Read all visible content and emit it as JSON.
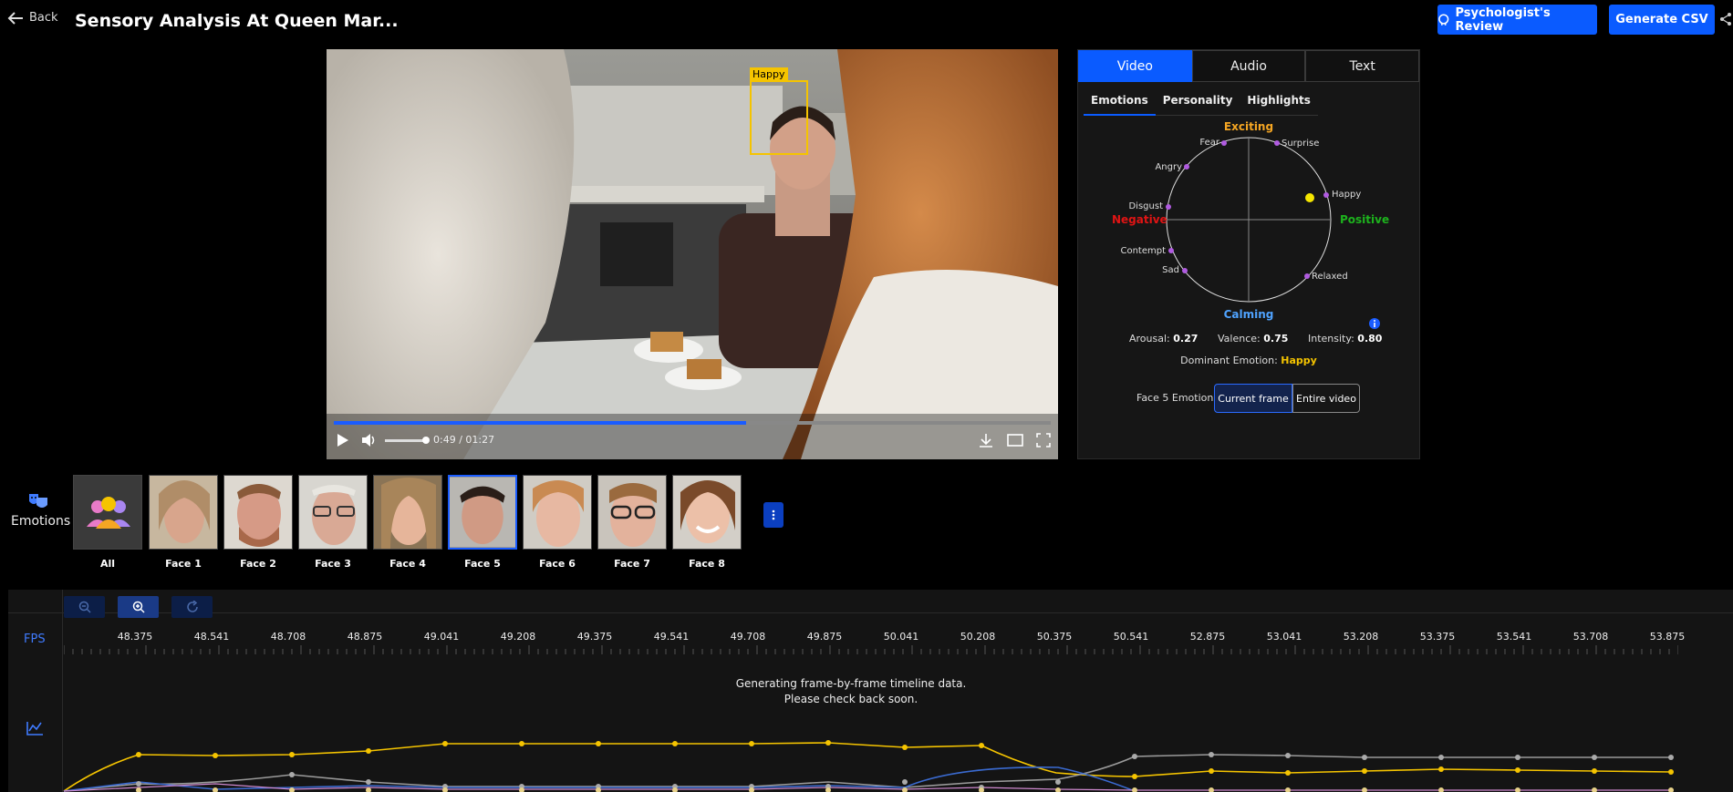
{
  "header": {
    "back_label": "Back",
    "title": "Sensory Analysis At Queen Mar...",
    "review_button": "Psychologist's Review",
    "csv_button": "Generate CSV"
  },
  "video": {
    "face_label": "Happy",
    "time": "0:49 / 01:27",
    "progress": 0.575
  },
  "panel": {
    "tabs": [
      "Video",
      "Audio",
      "Text"
    ],
    "active_tab": "Video",
    "subtabs": [
      "Emotions",
      "Personality",
      "Highlights"
    ],
    "active_subtab": "Emotions",
    "axes": {
      "top": "Exciting",
      "bottom": "Calming",
      "left": "Negative",
      "right": "Positive"
    },
    "emotions": [
      "Fear",
      "Surprise",
      "Angry",
      "Happy",
      "Disgust",
      "Contempt",
      "Relaxed",
      "Sad"
    ],
    "arousal_label": "Arousal:",
    "arousal_value": "0.27",
    "valence_label": "Valence:",
    "valence_value": "0.75",
    "intensity_label": "Intensity:",
    "intensity_value": "0.80",
    "dominant_label": "Dominant Emotion:",
    "dominant_value": "Happy",
    "face_emotions_label": "Face 5 Emotions:",
    "current_frame_btn": "Current frame",
    "entire_video_btn": "Entire video"
  },
  "faces": {
    "nav_label": "Emotions",
    "items": [
      "All",
      "Face 1",
      "Face 2",
      "Face 3",
      "Face 4",
      "Face 5",
      "Face 6",
      "Face 7",
      "Face 8"
    ],
    "selected": "Face 5"
  },
  "timeline": {
    "fps_label": "FPS",
    "ticks": [
      "48.375",
      "48.541",
      "48.708",
      "48.875",
      "49.041",
      "49.208",
      "49.375",
      "49.541",
      "49.708",
      "49.875",
      "50.041",
      "50.208",
      "50.375",
      "50.541",
      "52.875",
      "53.041",
      "53.208",
      "53.375",
      "53.541",
      "53.708",
      "53.875"
    ],
    "message_line1": "Generating frame-by-frame timeline data.",
    "message_line2": "Please check back soon."
  },
  "colors": {
    "accent": "#0a5bff",
    "happy": "#f5c400",
    "negative": "#e01414",
    "positive": "#1db31d",
    "calming": "#4fa3ff",
    "exciting": "#f5a623"
  }
}
